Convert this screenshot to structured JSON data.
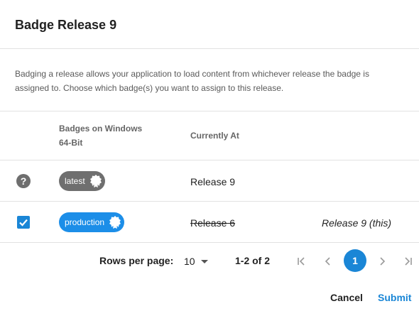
{
  "dialog": {
    "title": "Badge Release 9",
    "description": "Badging a release allows your application to load content from whichever release the badge is assigned to. Choose which badge(s) you want to assign to this release."
  },
  "table": {
    "headers": {
      "badges_line1": "Badges on Windows",
      "badges_line2": "64-Bit",
      "currently_at": "Currently At"
    },
    "rows": [
      {
        "badge": "latest",
        "currently_at": "Release 9",
        "new_release": "",
        "status_icon": "help-icon",
        "checked": false
      },
      {
        "badge": "production",
        "currently_at": "Release 6",
        "new_release": "Release 9 (this)",
        "status_icon": "checkbox",
        "checked": true
      }
    ]
  },
  "pagination": {
    "rows_per_page_label": "Rows per page:",
    "rows_per_page_value": "10",
    "range": "1-2 of 2",
    "current_page": "1"
  },
  "actions": {
    "cancel": "Cancel",
    "submit": "Submit"
  },
  "colors": {
    "accent": "#1a86d6",
    "badge_gray": "#6f6f6f",
    "badge_blue": "#1c8ee8"
  }
}
